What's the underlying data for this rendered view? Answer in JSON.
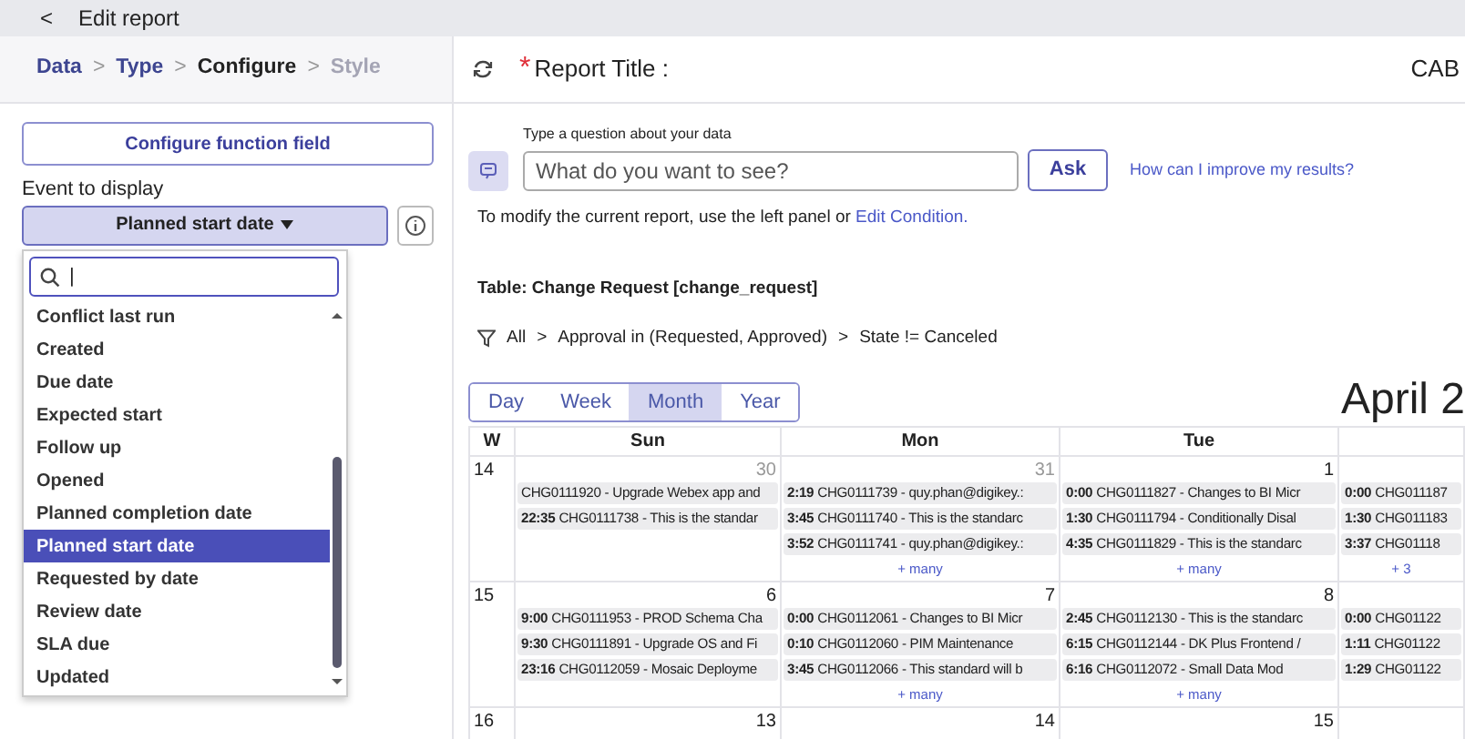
{
  "top_bar": {
    "back": "<",
    "title": "Edit report"
  },
  "stepper": {
    "separator": ">",
    "steps": [
      {
        "label": "Data",
        "kind": "done"
      },
      {
        "label": "Type",
        "kind": "done"
      },
      {
        "label": "Configure",
        "kind": "current"
      },
      {
        "label": "Style",
        "kind": "upcoming"
      }
    ]
  },
  "left_panel": {
    "configure_button": "Configure function field",
    "event_label": "Event to display",
    "event_select": "Planned start date",
    "dropdown": {
      "search_value": "|",
      "items": [
        {
          "label": "Conflict last run",
          "selected": false
        },
        {
          "label": "Created",
          "selected": false
        },
        {
          "label": "Due date",
          "selected": false
        },
        {
          "label": "Expected start",
          "selected": false
        },
        {
          "label": "Follow up",
          "selected": false
        },
        {
          "label": "Opened",
          "selected": false
        },
        {
          "label": "Planned completion date",
          "selected": false
        },
        {
          "label": "Planned start date",
          "selected": true
        },
        {
          "label": "Requested by date",
          "selected": false
        },
        {
          "label": "Review date",
          "selected": false
        },
        {
          "label": "SLA due",
          "selected": false
        },
        {
          "label": "Updated",
          "selected": false
        }
      ]
    }
  },
  "header": {
    "required_mark": "*",
    "title_label": "Report Title :",
    "title_value": "CAB"
  },
  "ask": {
    "label": "Type a question about your data",
    "placeholder": "What do you want to see?",
    "button": "Ask",
    "help_link": "How can I improve my results?"
  },
  "modify_text": "To modify the current report, use the left panel or",
  "modify_link": "Edit Condition.",
  "table_label": "Table: Change Request [change_request]",
  "filter": [
    "All",
    ">",
    "Approval in (Requested, Approved)",
    ">",
    "State != Canceled"
  ],
  "calendar": {
    "views": [
      {
        "label": "Day",
        "selected": false
      },
      {
        "label": "Week",
        "selected": false
      },
      {
        "label": "Month",
        "selected": true
      },
      {
        "label": "Year",
        "selected": false
      }
    ],
    "month_title": "April 2",
    "columns": [
      "W",
      "Sun",
      "Mon",
      "Tue"
    ],
    "weeks": [
      {
        "week": "14",
        "days": [
          {
            "date": "30",
            "other_month": true,
            "events": [
              {
                "title": "CHG0111920 - Upgrade Webex app and"
              },
              {
                "time": "22:35",
                "title": "CHG0111738 - This is the standar"
              }
            ]
          },
          {
            "date": "31",
            "other_month": true,
            "events": [
              {
                "time": "2:19",
                "title": "CHG0111739 - quy.phan@digikey.:"
              },
              {
                "time": "3:45",
                "title": "CHG0111740 - This is the standarc"
              },
              {
                "time": "3:52",
                "title": "CHG0111741 - quy.phan@digikey.:"
              }
            ],
            "more": "+ many"
          },
          {
            "date": "1",
            "other_month": false,
            "events": [
              {
                "time": "0:00",
                "title": "CHG0111827 - Changes to BI Micr"
              },
              {
                "time": "1:30",
                "title": "CHG0111794 - Conditionally Disal"
              },
              {
                "time": "4:35",
                "title": "CHG0111829 - This is the standarc"
              }
            ],
            "more": "+ many"
          },
          {
            "events": [
              {
                "time": "0:00",
                "title": "CHG011187"
              },
              {
                "time": "1:30",
                "title": "CHG011183"
              },
              {
                "time": "3:37",
                "title": "CHG01118"
              }
            ],
            "more": "+ 3"
          }
        ]
      },
      {
        "week": "15",
        "days": [
          {
            "date": "6",
            "other_month": false,
            "events": [
              {
                "time": "9:00",
                "title": "CHG0111953 - PROD Schema Cha"
              },
              {
                "time": "9:30",
                "title": "CHG0111891 - Upgrade OS and Fi"
              },
              {
                "time": "23:16",
                "title": "CHG0112059 - Mosaic Deployme"
              }
            ]
          },
          {
            "date": "7",
            "other_month": false,
            "events": [
              {
                "time": "0:00",
                "title": "CHG0112061 - Changes to BI Micr"
              },
              {
                "time": "0:10",
                "title": "CHG0112060 - PIM Maintenance"
              },
              {
                "time": "3:45",
                "title": "CHG0112066 - This standard will b"
              }
            ],
            "more": "+ many"
          },
          {
            "date": "8",
            "other_month": false,
            "events": [
              {
                "time": "2:45",
                "title": "CHG0112130 - This is the standarc"
              },
              {
                "time": "6:15",
                "title": "CHG0112144 - DK Plus Frontend /"
              },
              {
                "time": "6:16",
                "title": "CHG0112072 - Small Data Mod"
              }
            ],
            "more": "+ many"
          },
          {
            "events": [
              {
                "time": "0:00",
                "title": "CHG01122"
              },
              {
                "time": "1:11",
                "title": "CHG01122"
              },
              {
                "time": "1:29",
                "title": "CHG01122"
              }
            ]
          }
        ]
      },
      {
        "week": "16",
        "days": [
          {
            "date": "13",
            "other_month": false
          },
          {
            "date": "14",
            "other_month": false
          },
          {
            "date": "15",
            "other_month": false
          }
        ]
      }
    ]
  }
}
